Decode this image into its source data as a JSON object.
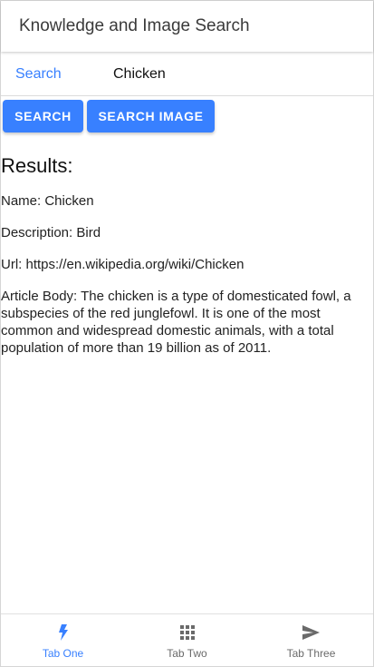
{
  "header": {
    "title": "Knowledge and Image Search"
  },
  "search": {
    "label": "Search",
    "value": "Chicken"
  },
  "buttons": {
    "search": "SEARCH",
    "search_image": "SEARCH IMAGE"
  },
  "results": {
    "heading": "Results:",
    "name": "Name: Chicken",
    "description": "Description: Bird",
    "url": "Url: https://en.wikipedia.org/wiki/Chicken",
    "article": "Article Body: The chicken is a type of domesticated fowl, a subspecies of the red junglefowl. It is one of the most common and widespread domestic animals, with a total population of more than 19 billion as of 2011."
  },
  "tabs": [
    {
      "label": "Tab One",
      "icon": "flash-icon",
      "active": true
    },
    {
      "label": "Tab Two",
      "icon": "apps-grid-icon",
      "active": false
    },
    {
      "label": "Tab Three",
      "icon": "send-icon",
      "active": false
    }
  ],
  "colors": {
    "accent": "#3880ff",
    "inactive": "#6a6a6a"
  }
}
